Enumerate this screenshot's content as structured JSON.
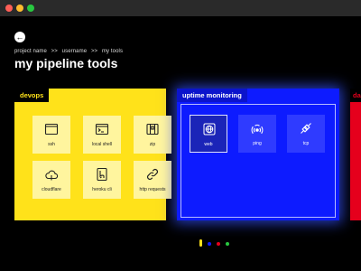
{
  "window": {
    "controls": [
      "close",
      "minimize",
      "maximize"
    ]
  },
  "nav": {
    "back_icon": "←"
  },
  "breadcrumb": [
    "project name",
    ">>",
    "username",
    ">>",
    "my tools"
  ],
  "page": {
    "title": "my pipeline tools"
  },
  "panels": {
    "devops": {
      "label": "devops",
      "color": "#ffe21a",
      "tools": [
        {
          "label": "ssh",
          "icon": "terminal-window-icon"
        },
        {
          "label": "local shell",
          "icon": "shell-prompt-icon"
        },
        {
          "label": "zip",
          "icon": "archive-box-icon"
        },
        {
          "label": "cloudflare",
          "icon": "cloud-icon"
        },
        {
          "label": "heroku cli",
          "icon": "heroku-icon"
        },
        {
          "label": "http requests",
          "icon": "link-icon"
        }
      ]
    },
    "uptime": {
      "label": "uptime monitoring",
      "color": "#0d1bff",
      "tools": [
        {
          "label": "web",
          "icon": "globe-icon",
          "selected": true
        },
        {
          "label": "ping",
          "icon": "signal-icon"
        },
        {
          "label": "tcp",
          "icon": "connection-icon"
        }
      ]
    },
    "red": {
      "label": "da",
      "color": "#e5001c"
    }
  },
  "pager": {
    "dots": [
      {
        "color": "#ffe21a",
        "active": true
      },
      {
        "color": "#0d1bff",
        "active": false
      },
      {
        "color": "#e5001c",
        "active": false
      },
      {
        "color": "#28c840",
        "active": false
      }
    ]
  }
}
